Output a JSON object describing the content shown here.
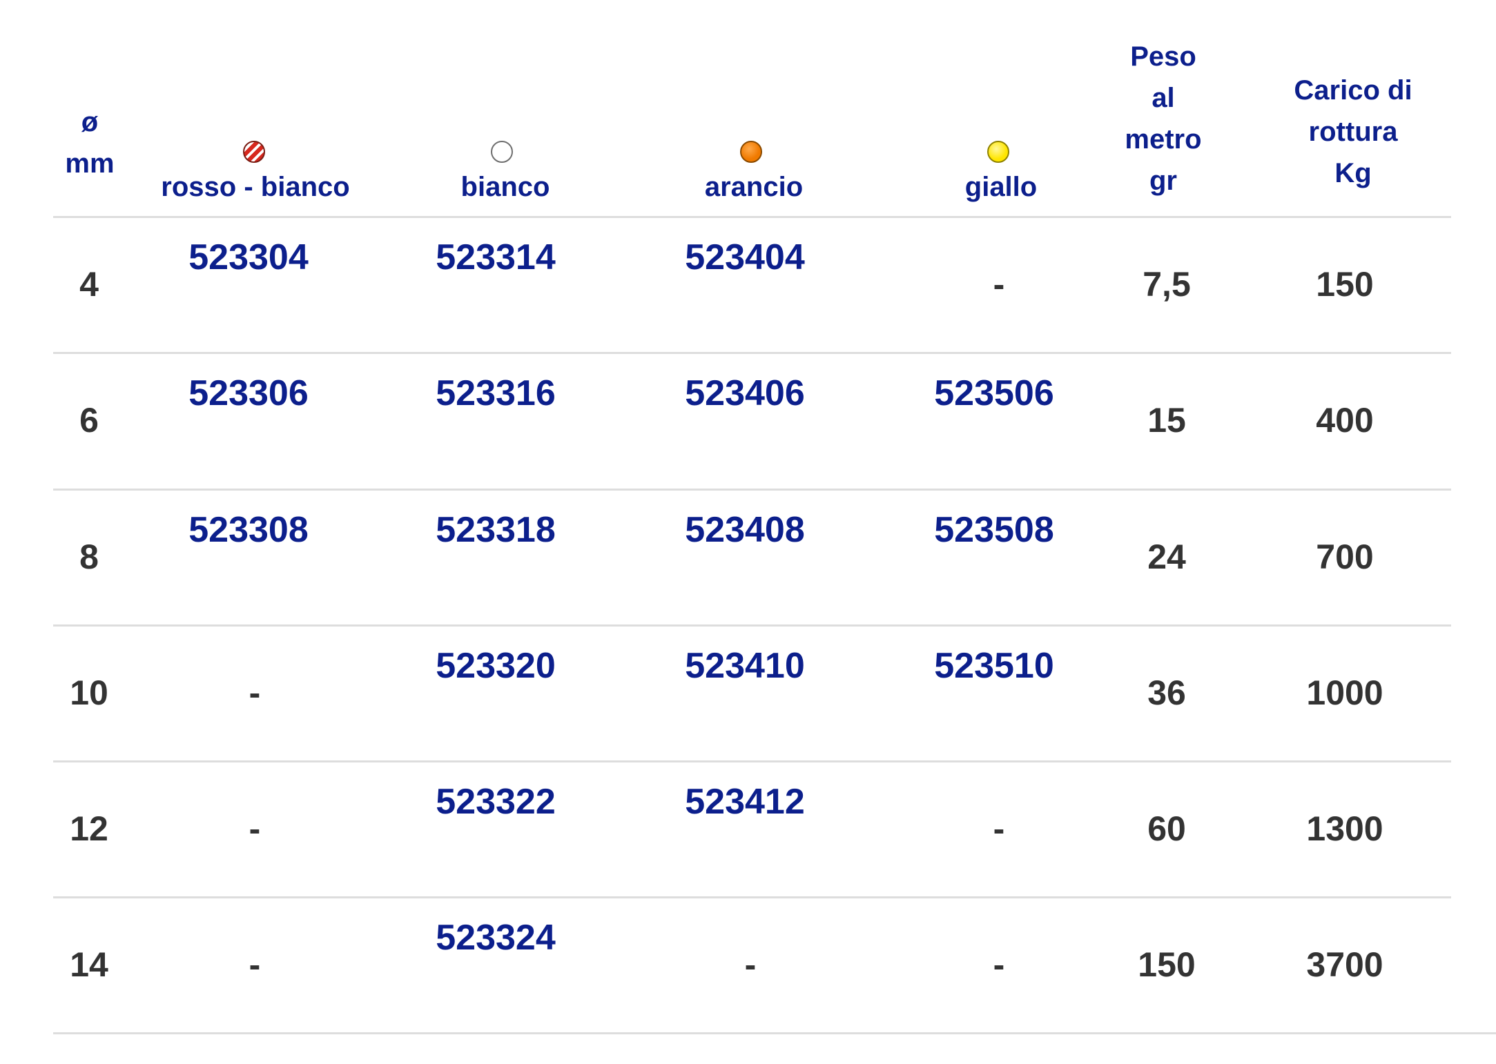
{
  "headers": {
    "diameter": [
      "ø",
      "mm"
    ],
    "colors": [
      {
        "label": "rosso - bianco",
        "icon": "red-white-ball-icon",
        "color": "#d7281e"
      },
      {
        "label": "bianco",
        "icon": "white-ball-icon",
        "color": "#ffffff"
      },
      {
        "label": "arancio",
        "icon": "orange-ball-icon",
        "color": "#f07a00"
      },
      {
        "label": "giallo",
        "icon": "yellow-ball-icon",
        "color": "#ffe600"
      }
    ],
    "weight": [
      "Peso",
      "al",
      "metro",
      "gr"
    ],
    "load": [
      "Carico di",
      "rottura",
      "Kg"
    ]
  },
  "rows": [
    {
      "diameter": "4",
      "codes": [
        "523304",
        "523314",
        "523404",
        "-"
      ],
      "weight": "7,5",
      "load": "150"
    },
    {
      "diameter": "6",
      "codes": [
        "523306",
        "523316",
        "523406",
        "523506"
      ],
      "weight": "15",
      "load": "400"
    },
    {
      "diameter": "8",
      "codes": [
        "523308",
        "523318",
        "523408",
        "523508"
      ],
      "weight": "24",
      "load": "700"
    },
    {
      "diameter": "10",
      "codes": [
        "-",
        "523320",
        "523410",
        "523510"
      ],
      "weight": "36",
      "load": "1000"
    },
    {
      "diameter": "12",
      "codes": [
        "-",
        "523322",
        "523412",
        "-"
      ],
      "weight": "60",
      "load": "1300"
    },
    {
      "diameter": "14",
      "codes": [
        "-",
        "523324",
        "-",
        "-"
      ],
      "weight": "150",
      "load": "3700"
    }
  ],
  "colors": {
    "header_text": "#0c1f8c",
    "body_text": "#333333",
    "rule": "#dddddd"
  }
}
